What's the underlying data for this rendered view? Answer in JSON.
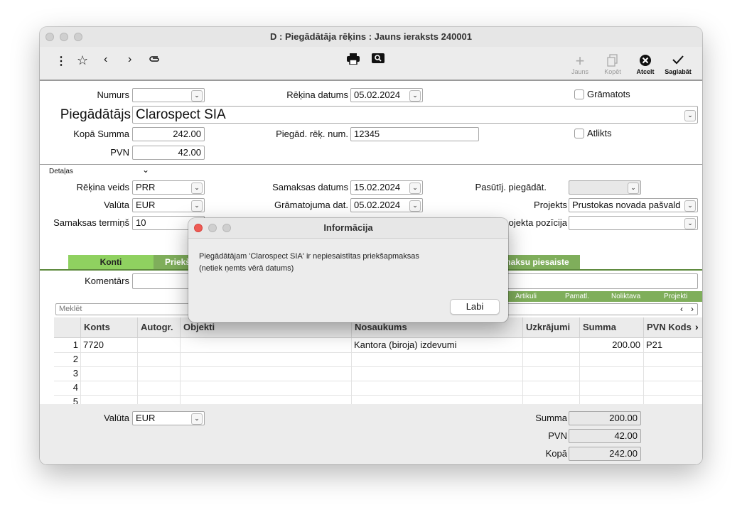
{
  "window": {
    "title": "D : Piegādātāja rēķins : Jauns ieraksts 240001"
  },
  "toolbar": {
    "icons": [
      "more-icon",
      "star-icon",
      "chevron-left-icon",
      "chevron-right-icon",
      "paperclip-icon",
      "print-icon",
      "preview-icon"
    ],
    "new_label": "Jauns",
    "copy_label": "Kopēt",
    "cancel_label": "Atcelt",
    "save_label": "Saglabāt"
  },
  "header": {
    "numurs_label": "Numurs",
    "numurs_value": "",
    "rekina_datums_label": "Rēķina datums",
    "rekina_datums_value": "05.02.2024",
    "gramatots_label": "Grāmatots",
    "piegadatajs_label": "Piegādātājs",
    "piegadatajs_value": "Clarospect SIA",
    "kopa_summa_label": "Kopā Summa",
    "kopa_summa_value": "242.00",
    "pieg_rek_num_label": "Piegād. rēķ. num.",
    "pieg_rek_num_value": "12345",
    "atlikts_label": "Atlikts",
    "pvn_label": "PVN",
    "pvn_value": "42.00"
  },
  "details": {
    "section_label": "Detaļas",
    "rekina_veids_label": "Rēķina veids",
    "rekina_veids_value": "PRR",
    "samaksas_datums_label": "Samaksas datums",
    "samaksas_datums_value": "15.02.2024",
    "pasutij_label": "Pasūtīj. piegādāt.",
    "pasutij_value": "",
    "valuta_label": "Valūta",
    "valuta_value": "EUR",
    "gramatojuma_label": "Grāmatojuma dat.",
    "gramatojuma_value": "05.02.2024",
    "projekts_label": "Projekts",
    "projekts_value": "Prustokas novada pašvald",
    "samaksas_termins_label": "Samaksas termiņš",
    "samaksas_termins_value": "10",
    "projekta_poz_label": "ojekta pozīcija",
    "projekta_poz_value": ""
  },
  "tabs": [
    {
      "label": "Konti"
    },
    {
      "label": "Priekš"
    },
    {
      "label": "maksu piesaiste"
    }
  ],
  "komentars_label": "Komentārs",
  "subtabs": [
    "Artikuli",
    "Pamatl.",
    "Noliktava",
    "Projekti"
  ],
  "search": {
    "placeholder": "Meklēt"
  },
  "grid": {
    "columns": [
      "Konts",
      "Autogr.",
      "Objekti",
      "Nosaukums",
      "Uzkrājumi",
      "Summa",
      "PVN Kods"
    ],
    "rows": [
      {
        "num": "1",
        "konts": "7720",
        "nosaukums": "Kantora (biroja) izdevumi",
        "summa": "200.00",
        "pvn_kods": "P21"
      },
      {
        "num": "2"
      },
      {
        "num": "3"
      },
      {
        "num": "4"
      },
      {
        "num": "5"
      }
    ]
  },
  "footer": {
    "valuta_label": "Valūta",
    "valuta_value": "EUR",
    "summa_label": "Summa",
    "summa_value": "200.00",
    "pvn_label": "PVN",
    "pvn_value": "42.00",
    "kopa_label": "Kopā",
    "kopa_value": "242.00"
  },
  "dialog": {
    "title": "Informācija",
    "message_line1": "Piegādātājam 'Clarospect SIA' ir nepiesaistītas priekšapmaksas",
    "message_line2": "(netiek ņemts vērā datums)",
    "ok_label": "Labi"
  },
  "colors": {
    "tab_active": "#8fd160",
    "tab_inactive": "#7fae5b",
    "close_red": "#ee5b54"
  }
}
